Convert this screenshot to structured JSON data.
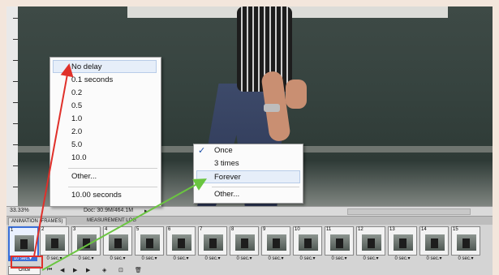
{
  "status_bar": {
    "zoom": "33.33%",
    "doc_info": "Doc: 30.9M/464.1M"
  },
  "panel": {
    "tabs": [
      "ANIMATION (FRAMES)",
      "MEASUREMENT LOG"
    ]
  },
  "frames": [
    {
      "num": "1",
      "delay": "10 sec.▾"
    },
    {
      "num": "2",
      "delay": "0 sec.▾"
    },
    {
      "num": "3",
      "delay": "0 sec.▾"
    },
    {
      "num": "4",
      "delay": "0 sec.▾"
    },
    {
      "num": "5",
      "delay": "0 sec.▾"
    },
    {
      "num": "6",
      "delay": "0 sec.▾"
    },
    {
      "num": "7",
      "delay": "0 sec.▾"
    },
    {
      "num": "8",
      "delay": "0 sec.▾"
    },
    {
      "num": "9",
      "delay": "0 sec.▾"
    },
    {
      "num": "10",
      "delay": "0 sec.▾"
    },
    {
      "num": "11",
      "delay": "0 sec.▾"
    },
    {
      "num": "12",
      "delay": "0 sec.▾"
    },
    {
      "num": "13",
      "delay": "0 sec.▾"
    },
    {
      "num": "14",
      "delay": "0 sec.▾"
    },
    {
      "num": "15",
      "delay": "0 sec.▾"
    }
  ],
  "loop_select": {
    "value": "Once"
  },
  "delay_menu": {
    "items": [
      "No delay",
      "0.1 seconds",
      "0.2",
      "0.5",
      "1.0",
      "2.0",
      "5.0",
      "10.0",
      "Other...",
      "10.00 seconds"
    ]
  },
  "loop_menu": {
    "items": [
      "Once",
      "3 times",
      "Forever",
      "Other..."
    ],
    "checked": "✓"
  },
  "colors": {
    "annotation_red": "#e0302a",
    "annotation_green": "#6ac540",
    "selection_blue": "#3a6fd8"
  }
}
